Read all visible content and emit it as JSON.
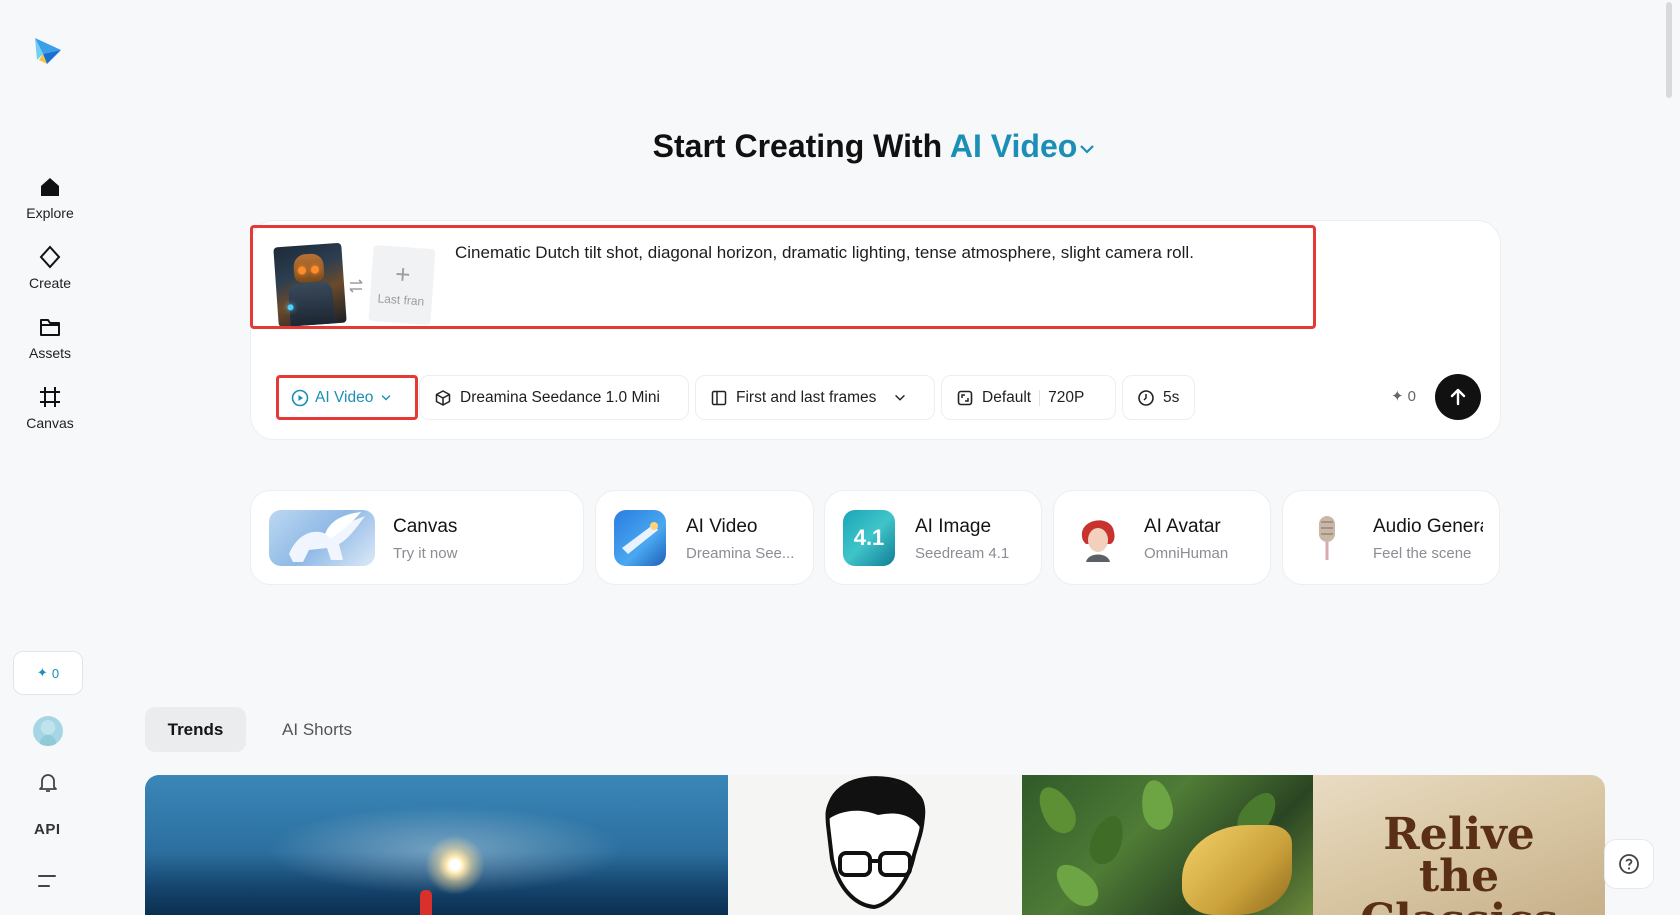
{
  "sidebar": {
    "items": [
      {
        "label": "Explore",
        "icon": "home-icon"
      },
      {
        "label": "Create",
        "icon": "diamond-icon"
      },
      {
        "label": "Assets",
        "icon": "folder-icon"
      },
      {
        "label": "Canvas",
        "icon": "frame-icon"
      }
    ],
    "credits": "0",
    "api_label": "API"
  },
  "header": {
    "prefix": "Start Creating With",
    "mode": "AI Video"
  },
  "prompt": {
    "text": "Cinematic Dutch tilt shot, diagonal horizon, dramatic lighting, tense atmosphere, slight camera roll.",
    "last_frame_label": "Last fran"
  },
  "toolbar": {
    "mode_label": "AI Video",
    "model_label": "Dreamina Seedance 1.0 Mini",
    "frames_label": "First and last frames",
    "ratio_label": "Default",
    "resolution_label": "720P",
    "duration_label": "5s",
    "credit_cost": "0"
  },
  "features": [
    {
      "title": "Canvas",
      "subtitle": "Try it now"
    },
    {
      "title": "AI Video",
      "subtitle": "Dreamina See..."
    },
    {
      "title": "AI Image",
      "subtitle": "Seedream 4.1",
      "badge": "4.1"
    },
    {
      "title": "AI Avatar",
      "subtitle": "OmniHuman"
    },
    {
      "title": "Audio Genera",
      "subtitle": "Feel the scene"
    }
  ],
  "tabs": [
    {
      "label": "Trends",
      "active": true
    },
    {
      "label": "AI Shorts",
      "active": false
    }
  ],
  "gallery": {
    "relive_line1": "Relive",
    "relive_line2": "the Classics"
  },
  "colors": {
    "accent": "#1b8fb5",
    "highlight": "#e53935",
    "background": "#f7f8fa"
  }
}
